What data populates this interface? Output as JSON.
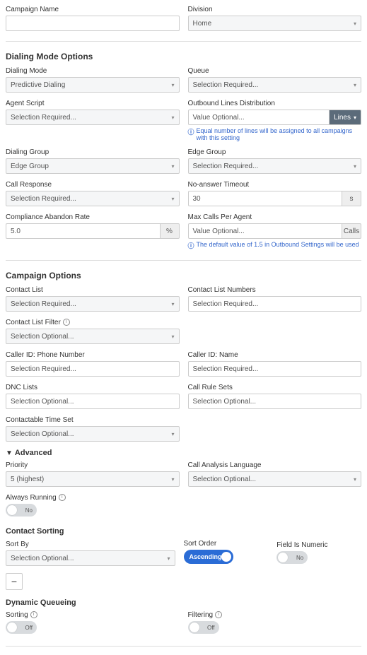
{
  "top": {
    "campaign_name_label": "Campaign Name",
    "division_label": "Division",
    "division_value": "Home"
  },
  "dialing_mode": {
    "section_title": "Dialing Mode Options",
    "dialing_mode_label": "Dialing Mode",
    "dialing_mode_value": "Predictive Dialing",
    "queue_label": "Queue",
    "queue_value": "Selection Required...",
    "agent_script_label": "Agent Script",
    "agent_script_value": "Selection Required...",
    "outbound_lines_label": "Outbound Lines Distribution",
    "outbound_lines_value": "Value Optional...",
    "outbound_lines_suffix": "Lines",
    "outbound_note": "Equal number of lines will be assigned to all campaigns with this setting",
    "dialing_group_label": "Dialing Group",
    "dialing_group_value": "Edge Group",
    "edge_group_label": "Edge Group",
    "edge_group_value": "Selection Required...",
    "call_response_label": "Call Response",
    "call_response_value": "Selection Required...",
    "no_answer_label": "No-answer Timeout",
    "no_answer_value": "30",
    "no_answer_suffix": "s",
    "compliance_label": "Compliance Abandon Rate",
    "compliance_value": "5.0",
    "compliance_suffix": "%",
    "max_calls_label": "Max Calls Per Agent",
    "max_calls_value": "Value Optional...",
    "max_calls_suffix": "Calls",
    "max_calls_note": "The default value of 1.5 in Outbound Settings will be used"
  },
  "campaign_options": {
    "section_title": "Campaign Options",
    "contact_list_label": "Contact List",
    "contact_list_value": "Selection Required...",
    "contact_list_numbers_label": "Contact List Numbers",
    "contact_list_numbers_value": "Selection Required...",
    "contact_list_filter_label": "Contact List Filter",
    "contact_list_filter_value": "Selection Optional...",
    "caller_id_phone_label": "Caller ID: Phone Number",
    "caller_id_phone_value": "Selection Required...",
    "caller_id_name_label": "Caller ID: Name",
    "caller_id_name_value": "Selection Required...",
    "dnc_lists_label": "DNC Lists",
    "dnc_lists_value": "Selection Optional...",
    "call_rule_sets_label": "Call Rule Sets",
    "call_rule_sets_value": "Selection Optional...",
    "contactable_time_set_label": "Contactable Time Set",
    "contactable_time_set_value": "Selection Optional..."
  },
  "advanced": {
    "toggle_label": "Advanced",
    "priority_label": "Priority",
    "priority_value": "5 (highest)",
    "call_analysis_lang_label": "Call Analysis Language",
    "call_analysis_lang_value": "Selection Optional...",
    "always_running_label": "Always Running",
    "always_running_value": "No"
  },
  "contact_sorting": {
    "section_title": "Contact Sorting",
    "sort_by_label": "Sort By",
    "sort_by_value": "Selection Optional...",
    "sort_order_label": "Sort Order",
    "sort_order_value": "Ascending",
    "field_numeric_label": "Field Is Numeric",
    "field_numeric_value": "No",
    "minus": "−"
  },
  "dynamic_queueing": {
    "section_title": "Dynamic Queueing",
    "sorting_label": "Sorting",
    "sorting_value": "Off",
    "filtering_label": "Filtering",
    "filtering_value": "Off"
  }
}
